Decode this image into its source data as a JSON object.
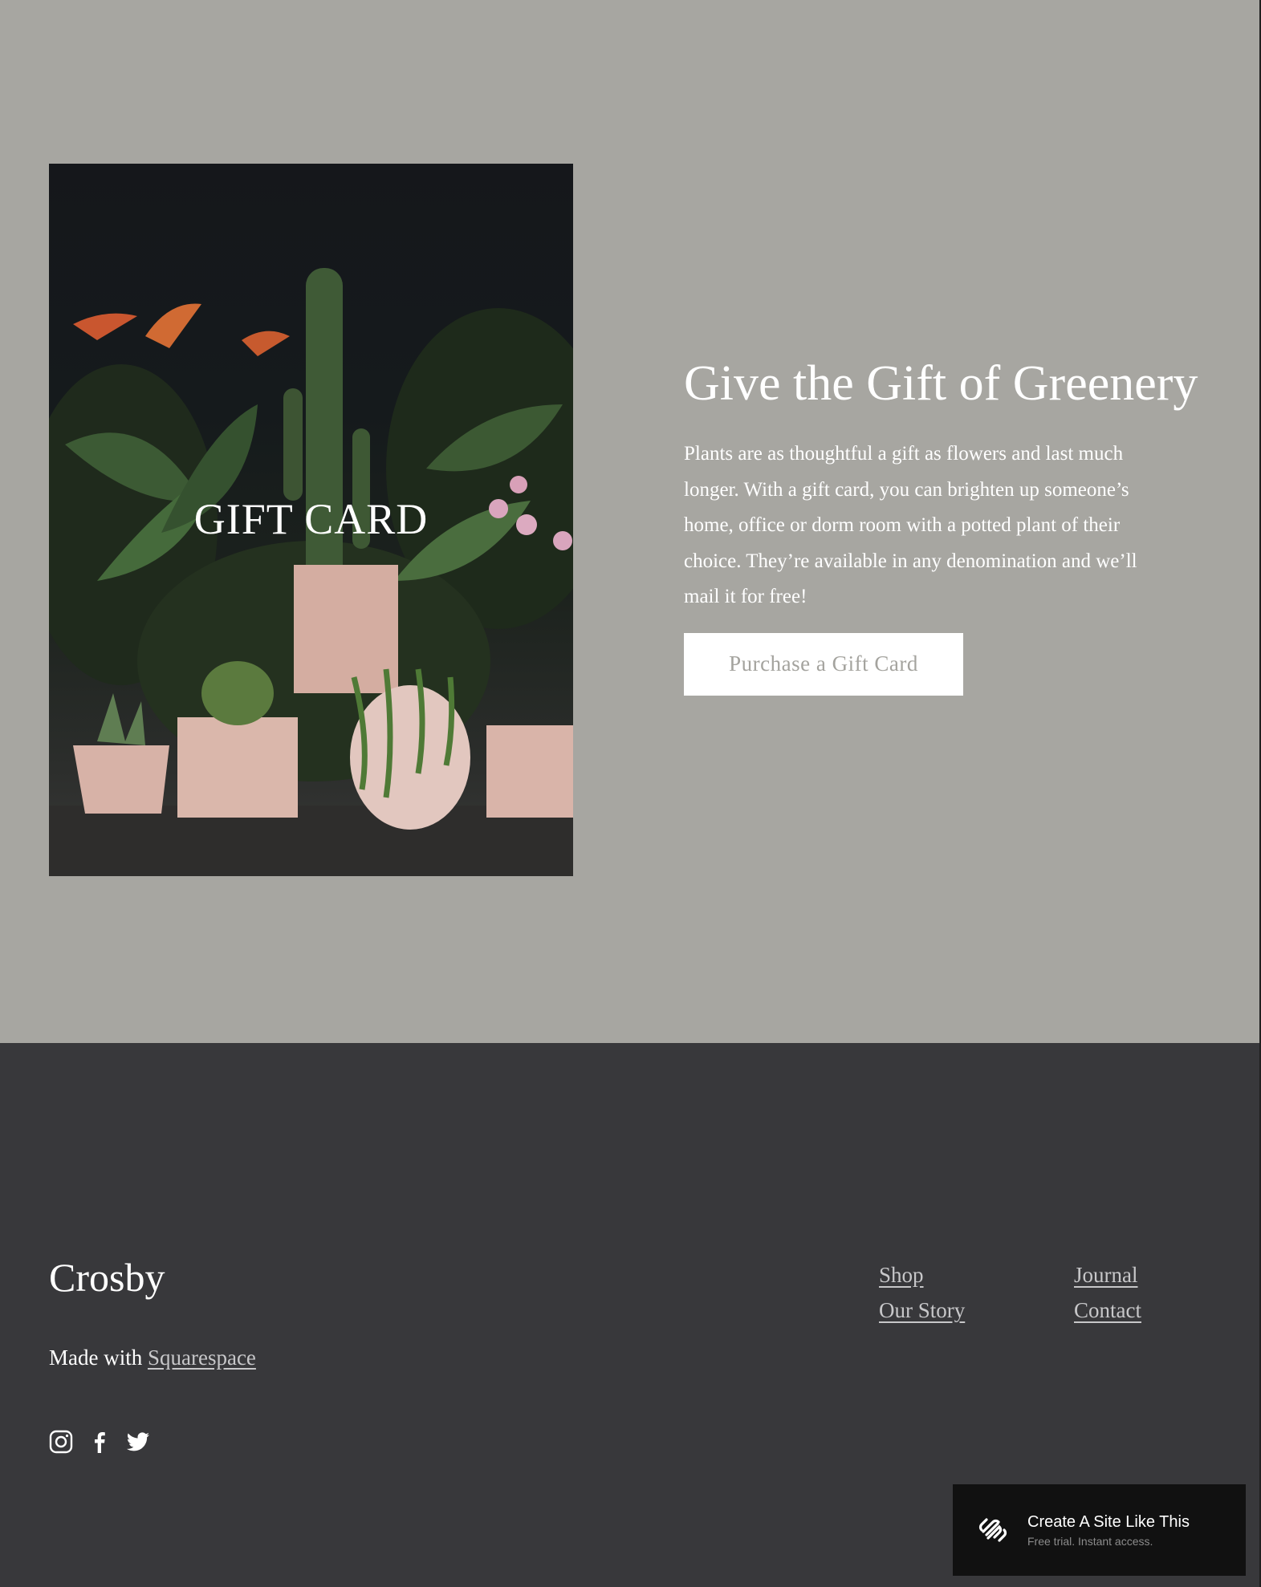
{
  "hero": {
    "image_label": "GIFT CARD",
    "title": "Give the Gift of Greenery",
    "body": "Plants are as thoughtful a gift as flowers and last much longer. With a gift card, you can brighten up someone’s home, office or dorm room with a potted plant of their choice. They’re available in any denomination and we’ll mail it for free!",
    "button_label": "Purchase a Gift Card"
  },
  "footer": {
    "brand": "Crosby",
    "made_with_prefix": "Made with",
    "made_with_link": "Squarespace",
    "nav_col1": [
      "Shop",
      "Our Story"
    ],
    "nav_col2": [
      "Journal",
      "Contact"
    ],
    "socials": [
      "instagram-icon",
      "facebook-icon",
      "twitter-icon"
    ]
  },
  "badge": {
    "title": "Create A Site Like This",
    "subtitle": "Free trial. Instant access."
  },
  "colors": {
    "hero_bg": "#a7a6a1",
    "footer_bg": "#38383b",
    "badge_bg": "#111111",
    "button_text": "#a4a39e"
  }
}
